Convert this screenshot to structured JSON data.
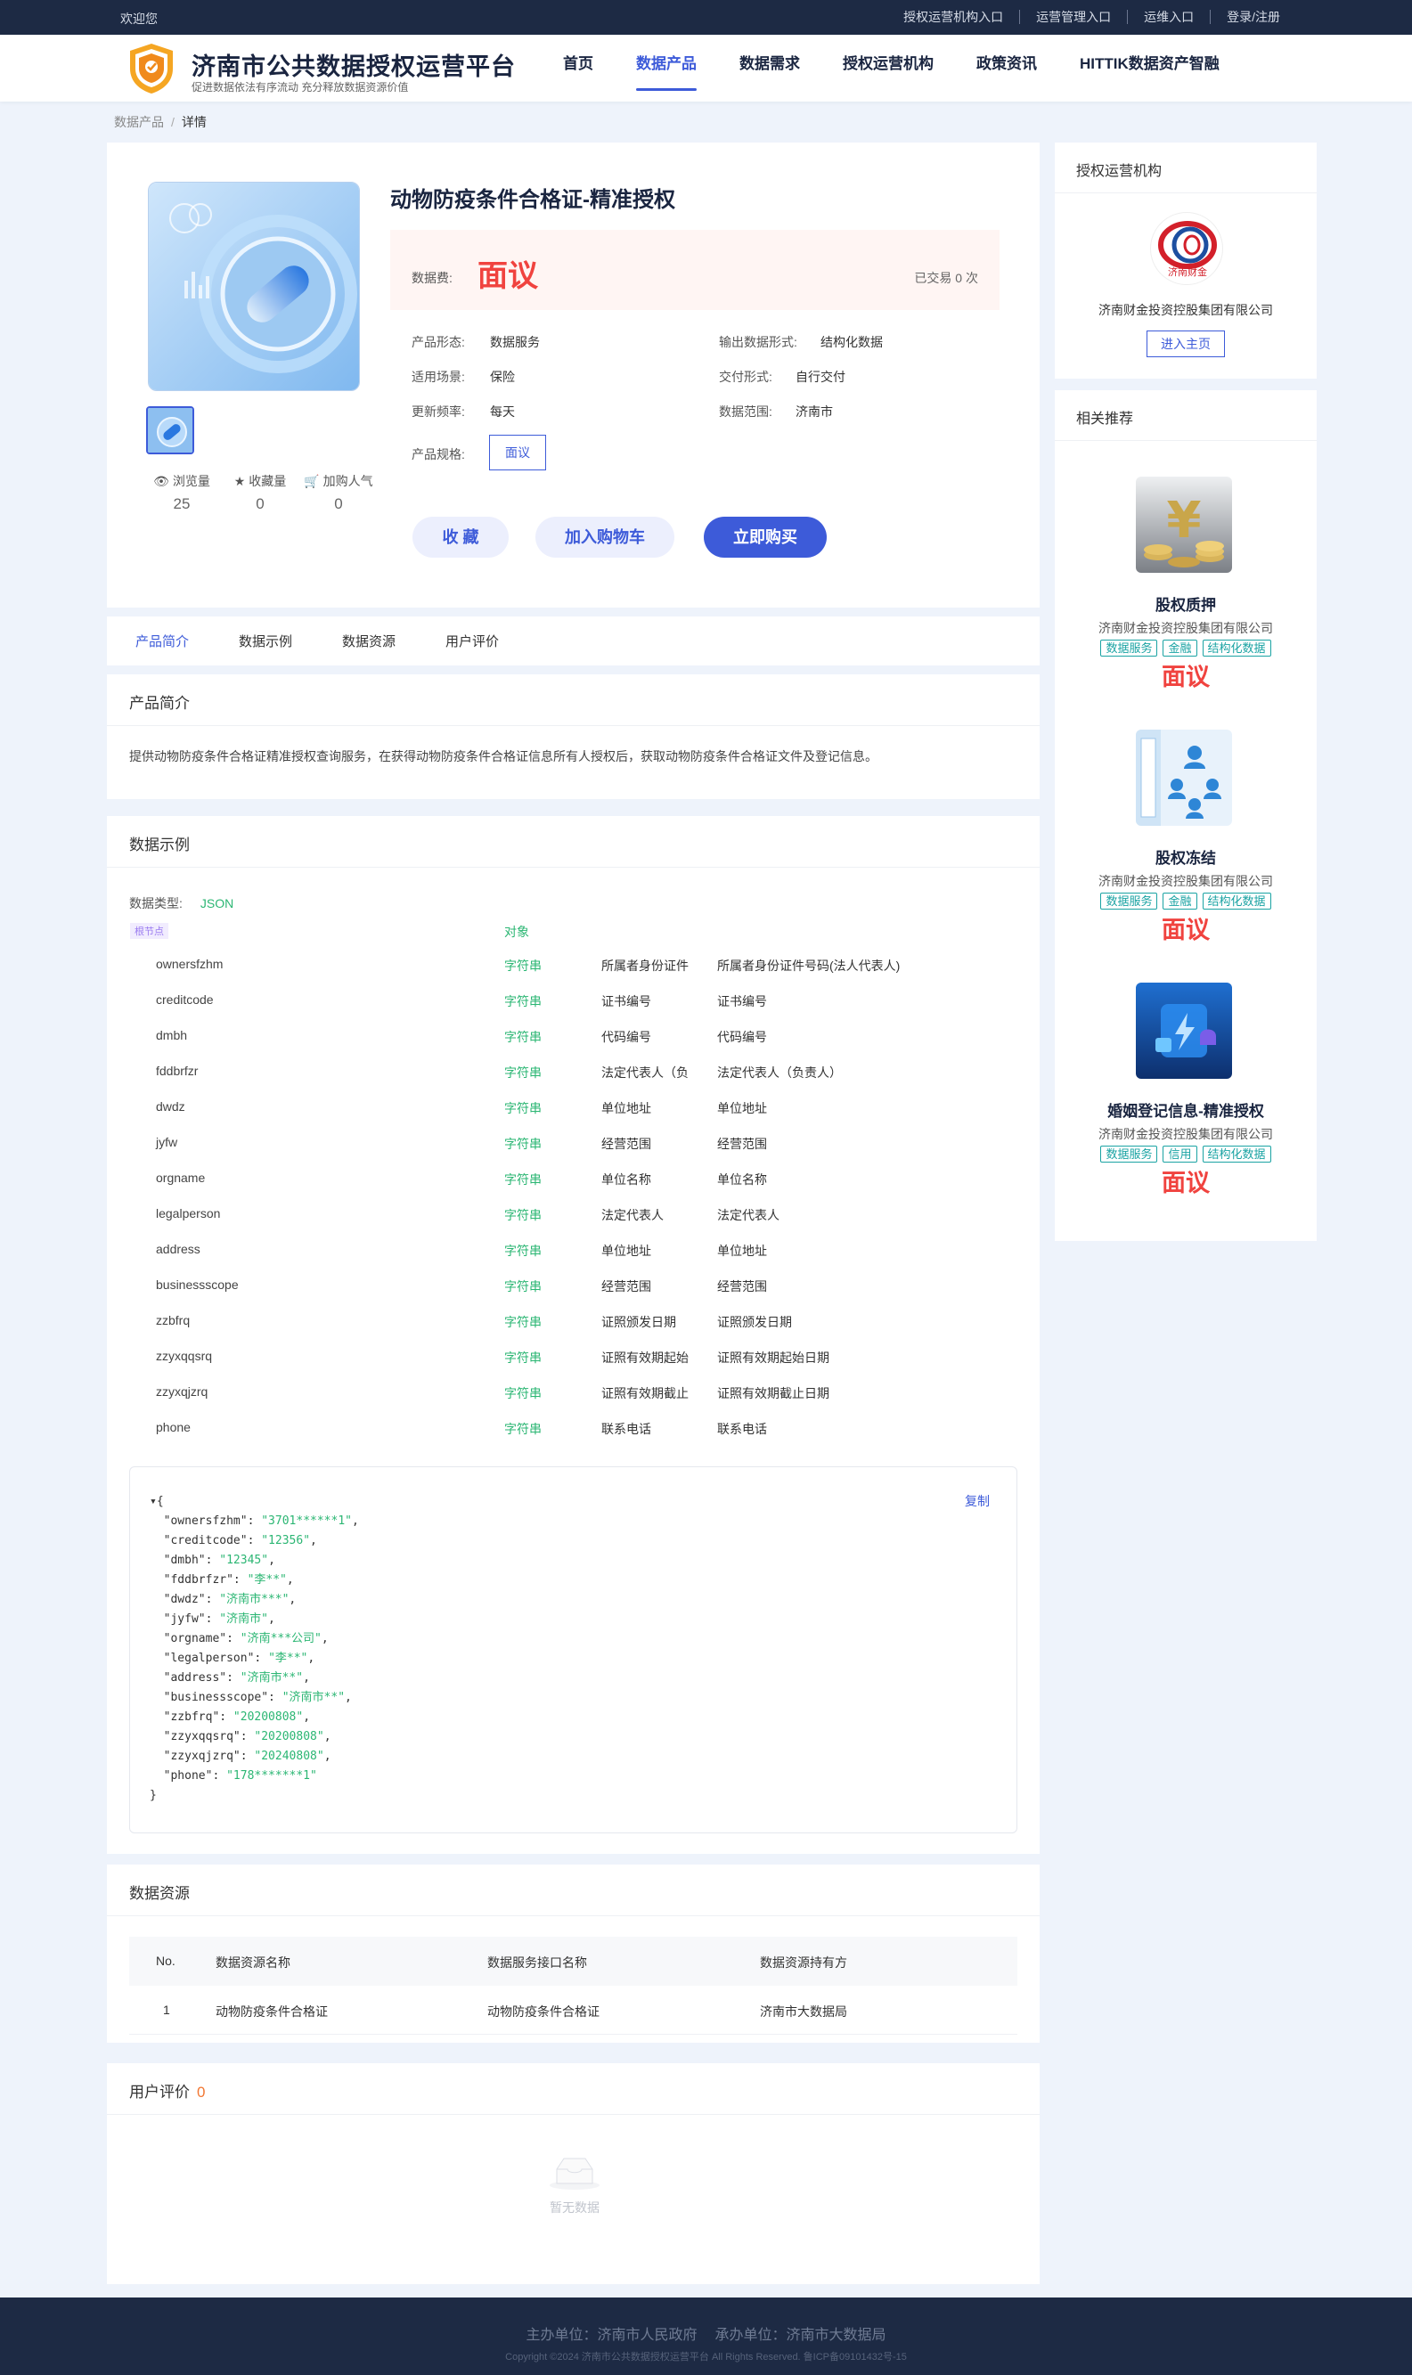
{
  "topbar": {
    "welcome": "欢迎您",
    "links": [
      "授权运营机构入口",
      "运营管理入口",
      "运维入口",
      "登录/注册"
    ]
  },
  "header": {
    "title": "济南市公共数据授权运营平台",
    "subtitle": "促进数据依法有序流动 充分释放数据资源价值",
    "nav": [
      "首页",
      "数据产品",
      "数据需求",
      "授权运营机构",
      "政策资讯",
      "HITTIK数据资产智融"
    ],
    "active_nav": "数据产品"
  },
  "breadcrumb": {
    "parent": "数据产品",
    "current": "详情"
  },
  "product": {
    "title": "动物防疫条件合格证-精准授权",
    "price_label": "数据费:",
    "price": "面议",
    "traded": "已交易 0 次",
    "attrs": [
      {
        "k": "产品形态:",
        "v": "数据服务"
      },
      {
        "k": "输出数据形式:",
        "v": "结构化数据"
      },
      {
        "k": "适用场景:",
        "v": "保险"
      },
      {
        "k": "交付形式:",
        "v": "自行交付"
      },
      {
        "k": "更新频率:",
        "v": "每天"
      },
      {
        "k": "数据范围:",
        "v": "济南市"
      }
    ],
    "spec_label": "产品规格:",
    "spec_value": "面议",
    "stats": [
      {
        "label": "浏览量",
        "value": "25",
        "icon": "eye-icon"
      },
      {
        "label": "收藏量",
        "value": "0",
        "icon": "star-icon"
      },
      {
        "label": "加购人气",
        "value": "0",
        "icon": "cart-icon"
      }
    ],
    "buttons": {
      "favorite": "收 藏",
      "cart": "加入购物车",
      "buy": "立即购买"
    }
  },
  "tabs": [
    "产品简介",
    "数据示例",
    "数据资源",
    "用户评价"
  ],
  "intro": {
    "title": "产品简介",
    "text": "提供动物防疫条件合格证精准授权查询服务，在获得动物防疫条件合格证信息所有人授权后，获取动物防疫条件合格证文件及登记信息。"
  },
  "example": {
    "title": "数据示例",
    "type_label": "数据类型:",
    "type_value": "JSON",
    "root_label": "根节点",
    "root_type": "对象",
    "fields": [
      {
        "name": "ownersfzhm",
        "type": "字符串",
        "desc": "所属者身份证件",
        "desc2": "所属者身份证件号码(法人代表人)"
      },
      {
        "name": "creditcode",
        "type": "字符串",
        "desc": "证书编号",
        "desc2": "证书编号"
      },
      {
        "name": "dmbh",
        "type": "字符串",
        "desc": "代码编号",
        "desc2": "代码编号"
      },
      {
        "name": "fddbrfzr",
        "type": "字符串",
        "desc": "法定代表人（负",
        "desc2": "法定代表人（负责人）"
      },
      {
        "name": "dwdz",
        "type": "字符串",
        "desc": "单位地址",
        "desc2": "单位地址"
      },
      {
        "name": "jyfw",
        "type": "字符串",
        "desc": "经营范围",
        "desc2": "经营范围"
      },
      {
        "name": "orgname",
        "type": "字符串",
        "desc": "单位名称",
        "desc2": "单位名称"
      },
      {
        "name": "legalperson",
        "type": "字符串",
        "desc": "法定代表人",
        "desc2": "法定代表人"
      },
      {
        "name": "address",
        "type": "字符串",
        "desc": "单位地址",
        "desc2": "单位地址"
      },
      {
        "name": "businessscope",
        "type": "字符串",
        "desc": "经营范围",
        "desc2": "经营范围"
      },
      {
        "name": "zzbfrq",
        "type": "字符串",
        "desc": "证照颁发日期",
        "desc2": "证照颁发日期"
      },
      {
        "name": "zzyxqqsrq",
        "type": "字符串",
        "desc": "证照有效期起始",
        "desc2": "证照有效期起始日期"
      },
      {
        "name": "zzyxqjzrq",
        "type": "字符串",
        "desc": "证照有效期截止",
        "desc2": "证照有效期截止日期"
      },
      {
        "name": "phone",
        "type": "字符串",
        "desc": "联系电话",
        "desc2": "联系电话"
      }
    ],
    "copy_label": "复制",
    "json_sample": [
      {
        "k": "ownersfzhm",
        "v": "3701******1"
      },
      {
        "k": "creditcode",
        "v": "12356"
      },
      {
        "k": "dmbh",
        "v": "12345"
      },
      {
        "k": "fddbrfzr",
        "v": "李**"
      },
      {
        "k": "dwdz",
        "v": "济南市***"
      },
      {
        "k": "jyfw",
        "v": "济南市"
      },
      {
        "k": "orgname",
        "v": "济南***公司"
      },
      {
        "k": "legalperson",
        "v": "李**"
      },
      {
        "k": "address",
        "v": "济南市**"
      },
      {
        "k": "businessscope",
        "v": "济南市**"
      },
      {
        "k": "zzbfrq",
        "v": "20200808"
      },
      {
        "k": "zzyxqqsrq",
        "v": "20200808"
      },
      {
        "k": "zzyxqjzrq",
        "v": "20240808"
      },
      {
        "k": "phone",
        "v": "178*******1"
      }
    ]
  },
  "resource": {
    "title": "数据资源",
    "headers": [
      "No.",
      "数据资源名称",
      "数据服务接口名称",
      "数据资源持有方"
    ],
    "rows": [
      [
        "1",
        "动物防疫条件合格证",
        "动物防疫条件合格证",
        "济南市大数据局"
      ]
    ]
  },
  "review": {
    "title": "用户评价",
    "count": "0",
    "empty": "暂无数据"
  },
  "sidebar": {
    "org_title": "授权运营机构",
    "org_logo_text": "济南财金",
    "org_name": "济南财金投资控股集团有限公司",
    "org_button": "进入主页",
    "rec_title": "相关推荐",
    "recommendations": [
      {
        "name": "股权质押",
        "company": "济南财金投资控股集团有限公司",
        "tags": [
          "数据服务",
          "金融",
          "结构化数据"
        ],
        "price": "面议"
      },
      {
        "name": "股权冻结",
        "company": "济南财金投资控股集团有限公司",
        "tags": [
          "数据服务",
          "金融",
          "结构化数据"
        ],
        "price": "面议"
      },
      {
        "name": "婚姻登记信息-精准授权",
        "company": "济南财金投资控股集团有限公司",
        "tags": [
          "数据服务",
          "信用",
          "结构化数据"
        ],
        "price": "面议"
      }
    ]
  },
  "footer": {
    "sponsor": "主办单位：济南市人民政府",
    "organizer": "承办单位：济南市大数据局",
    "copyright": "Copyright ©2024 济南市公共数据授权运营平台 All Rights Reserved. 鲁ICP备09101432号-15"
  },
  "colors": {
    "primary": "#3d5bd9",
    "price": "#f0433f",
    "dark": "#1d2a44",
    "string": "#2bb673"
  }
}
